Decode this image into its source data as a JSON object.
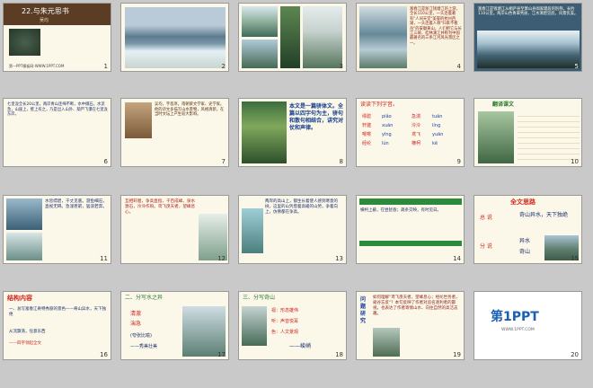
{
  "slides": [
    {
      "n": "1",
      "title": "22.与朱元思书",
      "author": "吴均",
      "footer": "第一PPT模板网-WWW.1PPT.COM"
    },
    {
      "n": "2"
    },
    {
      "n": "3"
    },
    {
      "n": "4",
      "text": "富春江是浙江钱塘江的上游，全长110公里，一头连着著有\"人间天堂\"美誉的杭州西湖，一头连着人称\"归来不看岳\"的安徽黄山，人们把它与长江三峡、桂林漓江并称为中国最著名的三条江河风光景区之一。"
    },
    {
      "n": "5",
      "text": "富春江是钱塘江从桐庐县至萧山县闻家堰段的别称，长约110公里。两岸山色青翠秀丽，江水清碧见底，风景优美。"
    },
    {
      "n": "6",
      "text": "七里泷全长20公里，两岸青山连绵不断，水中礁石，水流急，山崖上，壁上有之，乃是出入山外、葫芦飞瀑在七里泷东岸。"
    },
    {
      "n": "7",
      "text": "吴均，字叔庠，南朝梁文学家、史学家。他的诗文多描写山水景物，风格清新，在当时文坛上产生较大影响。"
    },
    {
      "n": "8",
      "text": "本文是一篇骈体文。全篇以四字句为主，骈句和散句相结合，讲究对仗和声律。"
    },
    {
      "n": "9",
      "header": "读读下列字音。",
      "pairs": [
        [
          "缥碧",
          "piǎo"
        ],
        [
          "急湍",
          "tuān"
        ],
        [
          "轩邈",
          "xuān"
        ],
        [
          "泠泠",
          "líng"
        ],
        [
          "嘤嘤",
          "yīng"
        ],
        [
          "鸢飞",
          "yuān"
        ],
        [
          "经纶",
          "lún"
        ],
        [
          "横柯",
          "kē"
        ]
      ]
    },
    {
      "n": "10",
      "header": "翻译课文"
    },
    {
      "n": "11",
      "text": "水皆缥碧，千丈见底。游鱼细石，直视无碍。急湍甚箭，猛浪若奔。"
    },
    {
      "n": "12",
      "text": "互相轩邈，争高直指，千百成峰。泉水激石，泠泠作响。鸢飞戾天者，望峰息心。"
    },
    {
      "n": "13",
      "text": "两岸的高山上，都生长着使人感到寒意的树。这里的山凭借着高峻的山势，争着向上，仿佛都在争高。"
    },
    {
      "n": "14",
      "text": "横柯上蔽，在昼犹昏；疏条交映，有时见日。"
    },
    {
      "n": "15",
      "title": "全文思路",
      "total": "总 说",
      "total_text": "奇山异水，天下独绝",
      "part": "分 说",
      "part_a": "异水",
      "part_b": "奇山"
    },
    {
      "n": "16",
      "title": "结构内容",
      "lines": [
        "一、总写富春江奇特秀丽的景色——奇山异水，天下独绝",
        "从流飘荡，任意东西",
        "——四字领起全文"
      ]
    },
    {
      "n": "17",
      "title": "二、分写水之异",
      "a": "清澈",
      "b": "湍急",
      "c": "(夸张比喻)",
      "d": "——秀美壮美"
    },
    {
      "n": "18",
      "title": "三、分写奇山",
      "items": [
        "视：形态雄伟",
        "听：声音悦耳",
        "色：人文景观"
      ],
      "end": "——峻峭"
    },
    {
      "n": "19",
      "title": "问题研究",
      "text": "如何理解\"鸢飞戾天者，望峰息心；经纶世务者，窥谷忘反\"？本句反映了作者对追名逐利者的鄙视，也表达了作者寄情山水、向往自然的高洁志趣。"
    },
    {
      "n": "20",
      "brand": "第1PPT",
      "sub": "WWW.1PPT.COM"
    }
  ]
}
